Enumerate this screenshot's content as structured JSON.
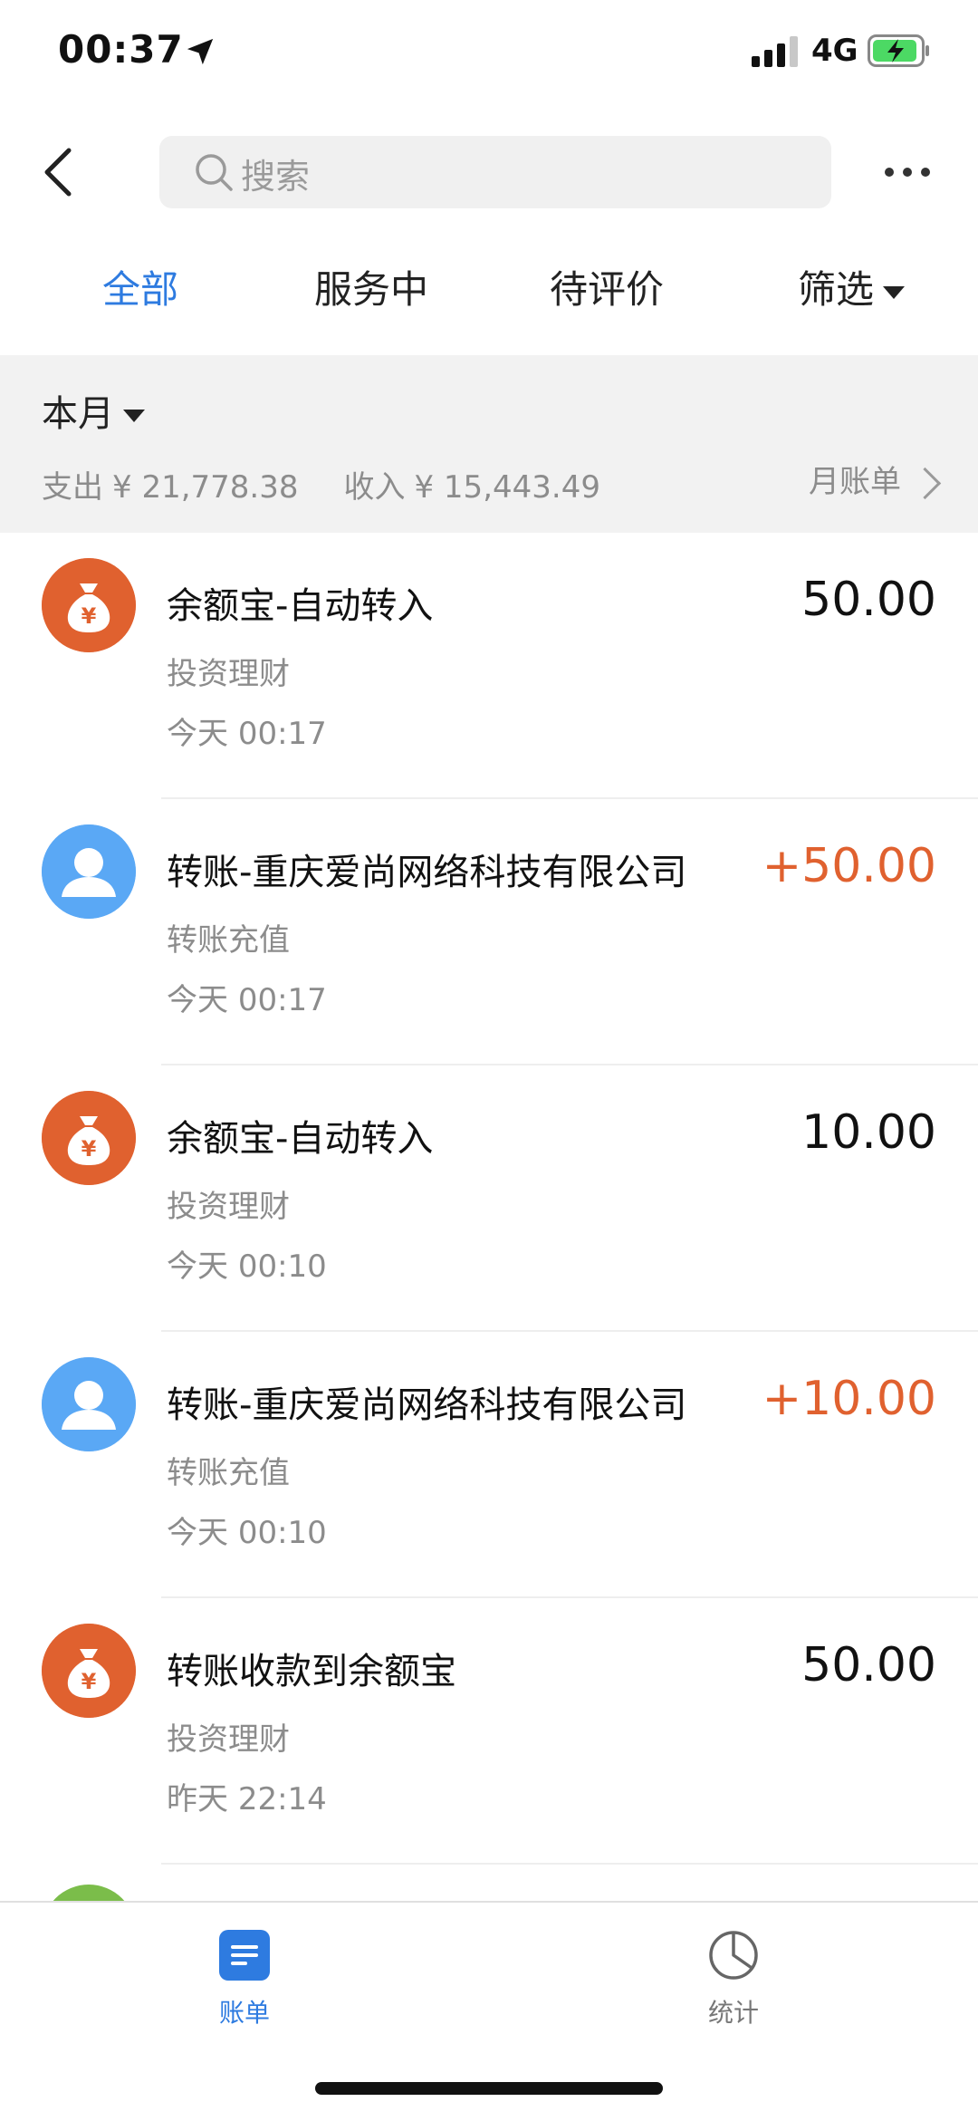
{
  "status_bar": {
    "time": "00:37",
    "network": "4G"
  },
  "search": {
    "placeholder": "搜索"
  },
  "tabs": [
    {
      "label": "全部",
      "active": true
    },
    {
      "label": "服务中",
      "active": false
    },
    {
      "label": "待评价",
      "active": false
    },
    {
      "label": "筛选",
      "active": false
    }
  ],
  "summary": {
    "period": "本月",
    "expense_label": "支出",
    "expense_value": "¥ 21,778.38",
    "income_label": "收入",
    "income_value": "¥ 15,443.49",
    "monthly_bill": "月账单"
  },
  "transactions": [
    {
      "title": "余额宝-自动转入",
      "category": "投资理财",
      "day": "今天",
      "time": "00:17",
      "amount": "50.00",
      "icon": "money-bag-icon"
    },
    {
      "title": "转账-重庆爱尚网络科技有限公司",
      "category": "转账充值",
      "day": "今天",
      "time": "00:17",
      "amount": "+50.00",
      "icon": "user-avatar-icon"
    },
    {
      "title": "余额宝-自动转入",
      "category": "投资理财",
      "day": "今天",
      "time": "00:10",
      "amount": "10.00",
      "icon": "money-bag-icon"
    },
    {
      "title": "转账-重庆爱尚网络科技有限公司",
      "category": "转账充值",
      "day": "今天",
      "time": "00:10",
      "amount": "+10.00",
      "icon": "user-avatar-icon"
    },
    {
      "title": "转账收款到余额宝",
      "category": "投资理财",
      "day": "昨天",
      "time": "22:14",
      "amount": "50.00",
      "icon": "money-bag-icon"
    }
  ],
  "tab_bar": {
    "bill": "账单",
    "stats": "统计"
  },
  "colors": {
    "accent": "#2e7be0",
    "income": "#e0612f",
    "money_icon": "#e0612f",
    "user_icon": "#5aa8f5"
  }
}
